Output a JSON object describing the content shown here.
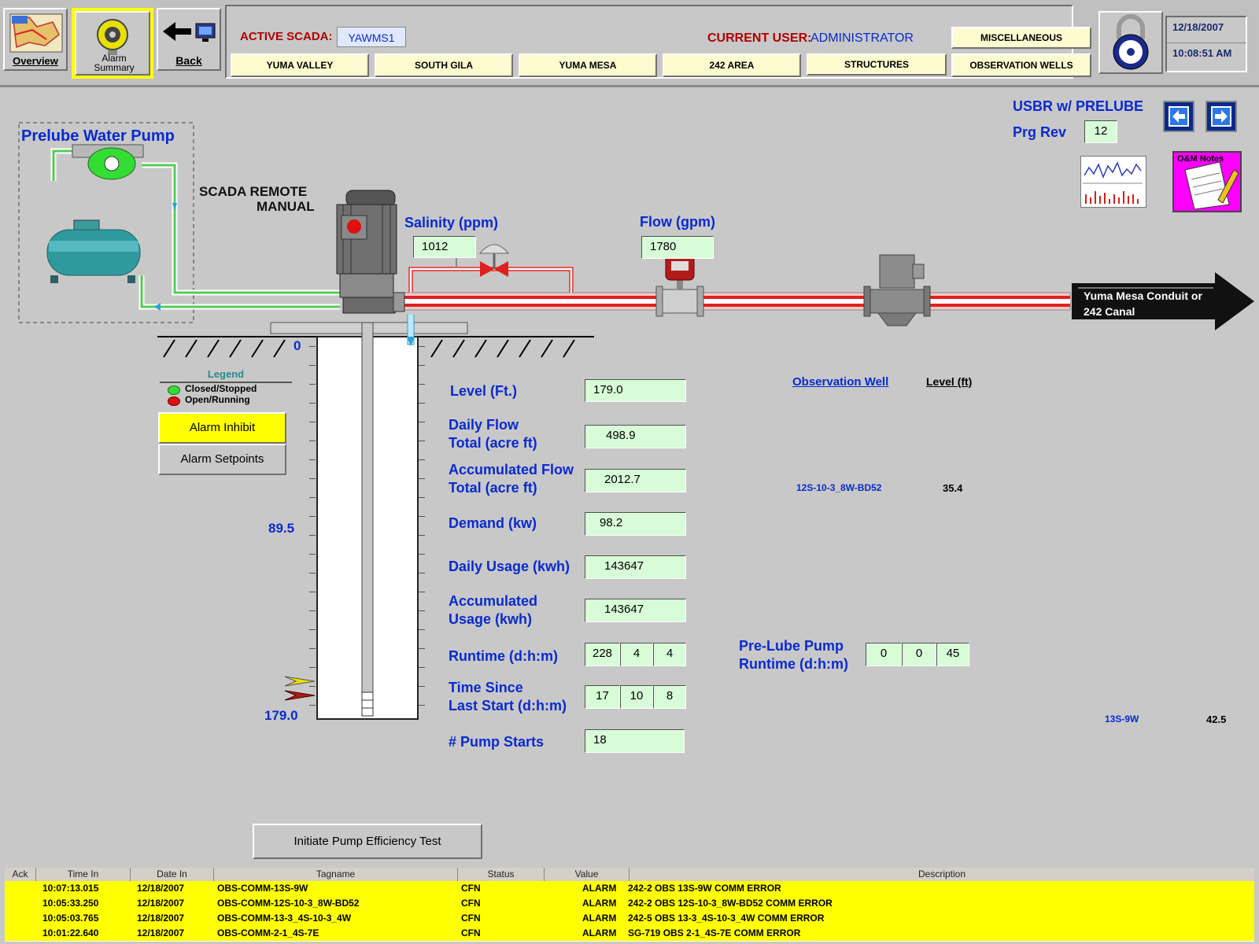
{
  "header": {
    "overview_label": "Overview",
    "alarm_summary_label": "Alarm Summary",
    "back_label": "Back",
    "active_scada_label": "ACTIVE SCADA:",
    "active_scada_value": "YAWMS1",
    "current_user_label": "CURRENT USER:",
    "current_user_value": "ADMINISTRATOR",
    "nav": [
      "YUMA VALLEY",
      "SOUTH GILA",
      "YUMA MESA",
      "242 AREA",
      "STRUCTURES",
      "OBSERVATION WELLS"
    ],
    "misc_label": "MISCELLANEOUS",
    "date": "12/18/2007",
    "time": "10:08:51 AM"
  },
  "diagram": {
    "prelube_title": "Prelube Water Pump",
    "mode_line1": "SCADA REMOTE",
    "mode_line2": "MANUAL",
    "salinity_label": "Salinity (ppm)",
    "salinity_value": "1012",
    "flow_label": "Flow (gpm)",
    "flow_value": "1780",
    "destination_line1": "Yuma Mesa Conduit or",
    "destination_line2": "242 Canal",
    "usbr_label": "USBR w/ PRELUBE",
    "prg_rev_label": "Prg Rev",
    "prg_rev_value": "12",
    "om_notes_label": "O&M Notes",
    "scale_top": "0",
    "scale_mid": "89.5",
    "scale_bottom": "179.0"
  },
  "legend": {
    "title": "Legend",
    "closed": "Closed/Stopped",
    "open": "Open/Running"
  },
  "buttons": {
    "alarm_inhibit": "Alarm Inhibit",
    "alarm_setpoints": "Alarm Setpoints",
    "efficiency_test": "Initiate Pump Efficiency Test"
  },
  "readings": {
    "level_label": "Level (Ft.)",
    "level_value": "179.0",
    "daily_flow_label1": "Daily Flow",
    "daily_flow_label2": "Total (acre ft)",
    "daily_flow_value": "498.9",
    "acc_flow_label1": "Accumulated Flow",
    "acc_flow_label2": "Total (acre ft)",
    "acc_flow_value": "2012.7",
    "demand_label": "Demand (kw)",
    "demand_value": "98.2",
    "daily_usage_label": "Daily Usage (kwh)",
    "daily_usage_value": "143647",
    "acc_usage_label1": "Accumulated",
    "acc_usage_label2": "Usage (kwh)",
    "acc_usage_value": "143647",
    "runtime_label": "Runtime (d:h:m)",
    "runtime_d": "228",
    "runtime_h": "4",
    "runtime_m": "4",
    "since_start_label1": "Time Since",
    "since_start_label2": "Last Start (d:h:m)",
    "since_start_d": "17",
    "since_start_h": "10",
    "since_start_m": "8",
    "pump_starts_label": "# Pump Starts",
    "pump_starts_value": "18",
    "prelube_runtime_label1": "Pre-Lube Pump",
    "prelube_runtime_label2": "Runtime (d:h:m)",
    "prelube_d": "0",
    "prelube_h": "0",
    "prelube_m": "45"
  },
  "observation": {
    "col_well": "Observation Well",
    "col_level": "Level (ft)",
    "wells": [
      {
        "name": "12S-10-3_8W-BD52",
        "level": "35.4"
      },
      {
        "name": "13S-9W",
        "level": "42.5"
      }
    ]
  },
  "alarms": {
    "columns": [
      "Ack",
      "Time In",
      "Date In",
      "Tagname",
      "Status",
      "Value",
      "Description"
    ],
    "rows": [
      {
        "ack": "",
        "time": "10:07:13.015",
        "date": "12/18/2007",
        "tag": "OBS-COMM-13S-9W",
        "status": "CFN",
        "value": "ALARM",
        "desc": "242-2 OBS 13S-9W COMM ERROR"
      },
      {
        "ack": "",
        "time": "10:05:33.250",
        "date": "12/18/2007",
        "tag": "OBS-COMM-12S-10-3_8W-BD52",
        "status": "CFN",
        "value": "ALARM",
        "desc": "242-2 OBS 12S-10-3_8W-BD52 COMM ERROR"
      },
      {
        "ack": "",
        "time": "10:05:03.765",
        "date": "12/18/2007",
        "tag": "OBS-COMM-13-3_4S-10-3_4W",
        "status": "CFN",
        "value": "ALARM",
        "desc": "242-5 OBS 13-3_4S-10-3_4W COMM ERROR"
      },
      {
        "ack": "",
        "time": "10:01:22.640",
        "date": "12/18/2007",
        "tag": "OBS-COMM-2-1_4S-7E",
        "status": "CFN",
        "value": "ALARM",
        "desc": "SG-719 OBS 2-1_4S-7E COMM ERROR"
      }
    ]
  },
  "colors": {
    "label_blue": "#0a2ad0",
    "field_green": "#d8fcd8",
    "alarm_yellow": "#ffff00",
    "nav_cream": "#fefbd0"
  }
}
